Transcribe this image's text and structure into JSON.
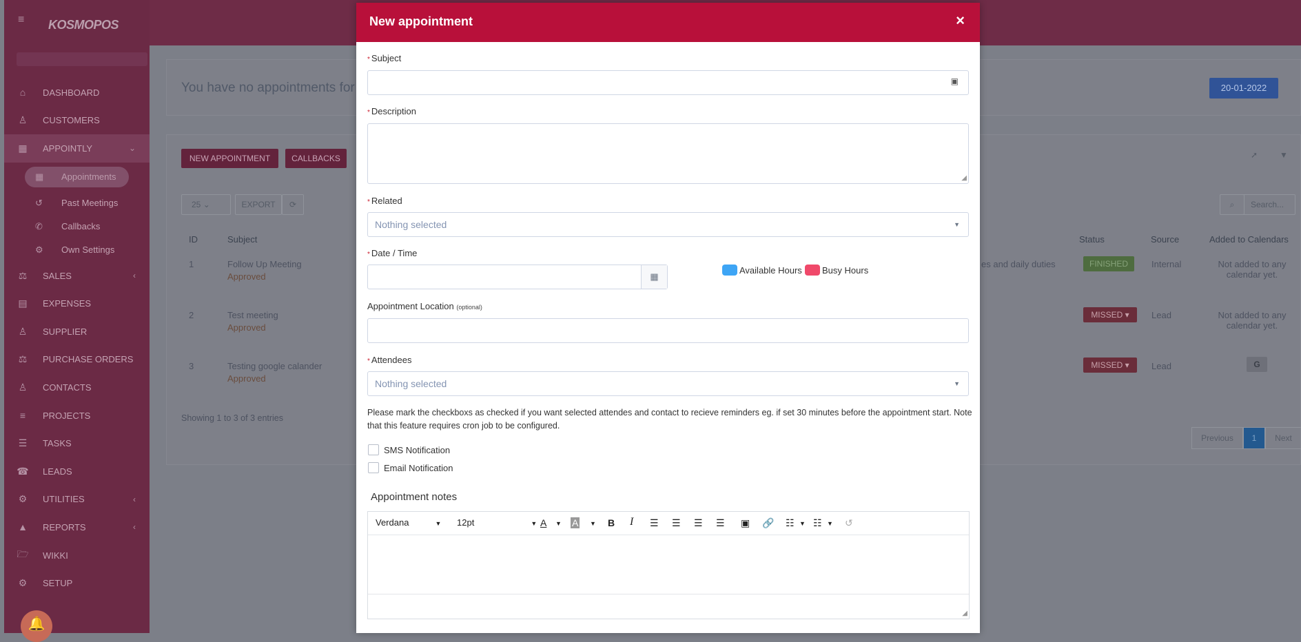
{
  "app": {
    "logo": "KOSMOPOS"
  },
  "sidebar": {
    "items": [
      {
        "label": "DASHBOARD",
        "icon": "home-icon",
        "glyph": "⌂"
      },
      {
        "label": "CUSTOMERS",
        "icon": "user-icon",
        "glyph": "♙"
      },
      {
        "label": "APPOINTLY",
        "icon": "calendar-icon",
        "glyph": "▦",
        "arrow": "⌄"
      },
      {
        "label": "SALES",
        "icon": "scale-icon",
        "glyph": "⚖",
        "arrow": "‹"
      },
      {
        "label": "EXPENSES",
        "icon": "file-icon",
        "glyph": "▤"
      },
      {
        "label": "SUPPLIER",
        "icon": "user-icon",
        "glyph": "♙"
      },
      {
        "label": "PURCHASE ORDERS",
        "icon": "scale-icon",
        "glyph": "⚖"
      },
      {
        "label": "CONTACTS",
        "icon": "user-icon",
        "glyph": "♙"
      },
      {
        "label": "PROJECTS",
        "icon": "bars-icon",
        "glyph": "≡"
      },
      {
        "label": "TASKS",
        "icon": "tasks-icon",
        "glyph": "☰"
      },
      {
        "label": "LEADS",
        "icon": "tty-icon",
        "glyph": "☎"
      },
      {
        "label": "UTILITIES",
        "icon": "cogs-icon",
        "glyph": "⚙",
        "arrow": "‹"
      },
      {
        "label": "REPORTS",
        "icon": "area-chart-icon",
        "glyph": "▲",
        "arrow": "‹"
      },
      {
        "label": "WIKKI",
        "icon": "folder-open-icon",
        "glyph": "🗁"
      },
      {
        "label": "SETUP",
        "icon": "gear-icon",
        "glyph": "⚙"
      }
    ],
    "subitems": [
      {
        "label": "Appointments",
        "icon": "table-icon",
        "glyph": "▦"
      },
      {
        "label": "Past Meetings",
        "icon": "history-icon",
        "glyph": "↺"
      },
      {
        "label": "Callbacks",
        "icon": "phone-icon",
        "glyph": "✆"
      },
      {
        "label": "Own Settings",
        "icon": "gear-icon",
        "glyph": "⚙"
      }
    ]
  },
  "background": {
    "no_appointments_msg": "You have no appointments for to",
    "date_button": "20-01-2022",
    "new_appointment_btn": "NEW APPOINTMENT",
    "callbacks_btn": "CALLBACKS",
    "page_length": "25",
    "export_btn": "EXPORT",
    "search_placeholder": "Search...",
    "columns": {
      "id": "ID",
      "subject": "Subject",
      "status": "Status",
      "source": "Source",
      "calendars": "Added to Calendars"
    },
    "rows": [
      {
        "id": "1",
        "subject": "Follow Up Meeting",
        "approval": "Approved",
        "desc": "es and daily duties",
        "status": "FINISHED",
        "source": "Internal",
        "calendar": "Not added to any calendar yet."
      },
      {
        "id": "2",
        "subject": "Test meeting",
        "approval": "Approved",
        "desc": "",
        "status": "MISSED ▾",
        "source": "Lead",
        "calendar": "Not added to any calendar yet."
      },
      {
        "id": "3",
        "subject": "Testing google calander",
        "approval": "Approved",
        "desc": "",
        "status": "MISSED ▾",
        "source": "Lead",
        "calendar": "G"
      }
    ],
    "showing": "Showing 1 to 3 of 3 entries",
    "pager": {
      "prev": "Previous",
      "page": "1",
      "next": "Next"
    }
  },
  "modal": {
    "title": "New appointment",
    "close": "×",
    "subject_label": "Subject",
    "description_label": "Description",
    "related_label": "Related",
    "related_value": "Nothing selected",
    "datetime_label": "Date / Time",
    "legend_available": "Available Hours",
    "legend_busy": "Busy Hours",
    "location_label": "Appointment Location",
    "location_optional": "(optional)",
    "attendees_label": "Attendees",
    "attendees_value": "Nothing selected",
    "reminder_note": "Please mark the checkboxs as checked if you want selected attendes and contact to recieve reminders eg. if set 30 minutes before the appointment start. Note that this feature requires cron job to be configured.",
    "sms_label": "SMS Notification",
    "email_label": "Email Notification",
    "notes_label": "Appointment notes",
    "editor": {
      "font": "Verdana",
      "size": "12pt"
    },
    "colors": {
      "header": "#b8103a",
      "available": "#3ea5f5",
      "busy": "#f0496a"
    }
  }
}
